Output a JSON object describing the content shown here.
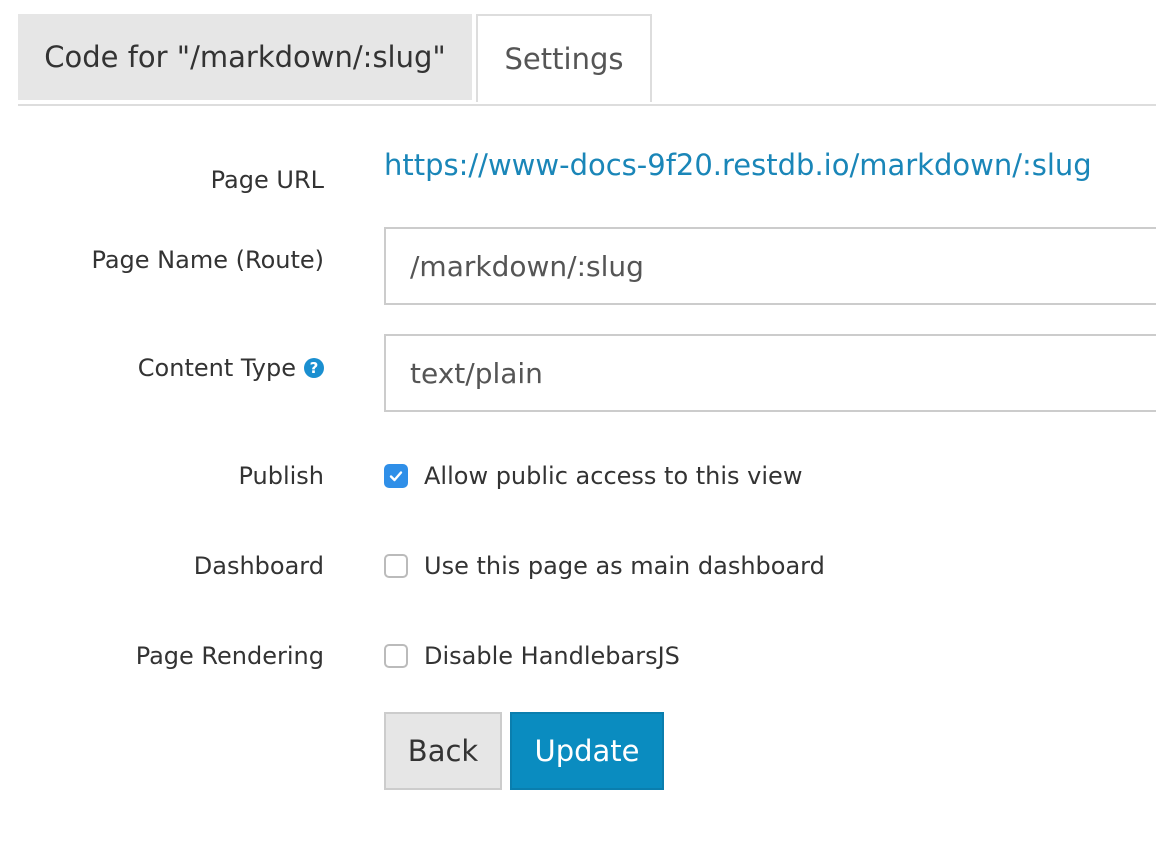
{
  "tabs": {
    "code": "Code for \"/markdown/:slug\"",
    "settings": "Settings"
  },
  "form": {
    "page_url": {
      "label": "Page URL",
      "value": "https://www-docs-9f20.restdb.io/markdown/:slug"
    },
    "page_name": {
      "label": "Page Name (Route)",
      "value": "/markdown/:slug"
    },
    "content_type": {
      "label": "Content Type",
      "value": "text/plain",
      "help_icon": "question-circle-icon"
    },
    "publish": {
      "label": "Publish",
      "checkbox_label": "Allow public access to this view",
      "checked": true
    },
    "dashboard": {
      "label": "Dashboard",
      "checkbox_label": "Use this page as main dashboard",
      "checked": false
    },
    "page_rendering": {
      "label": "Page Rendering",
      "checkbox_label": "Disable HandlebarsJS",
      "checked": false
    }
  },
  "buttons": {
    "back": "Back",
    "update": "Update"
  },
  "colors": {
    "link": "#1a86b8",
    "primary": "#0a8cc0",
    "checkbox_checked": "#2f8fe8"
  }
}
